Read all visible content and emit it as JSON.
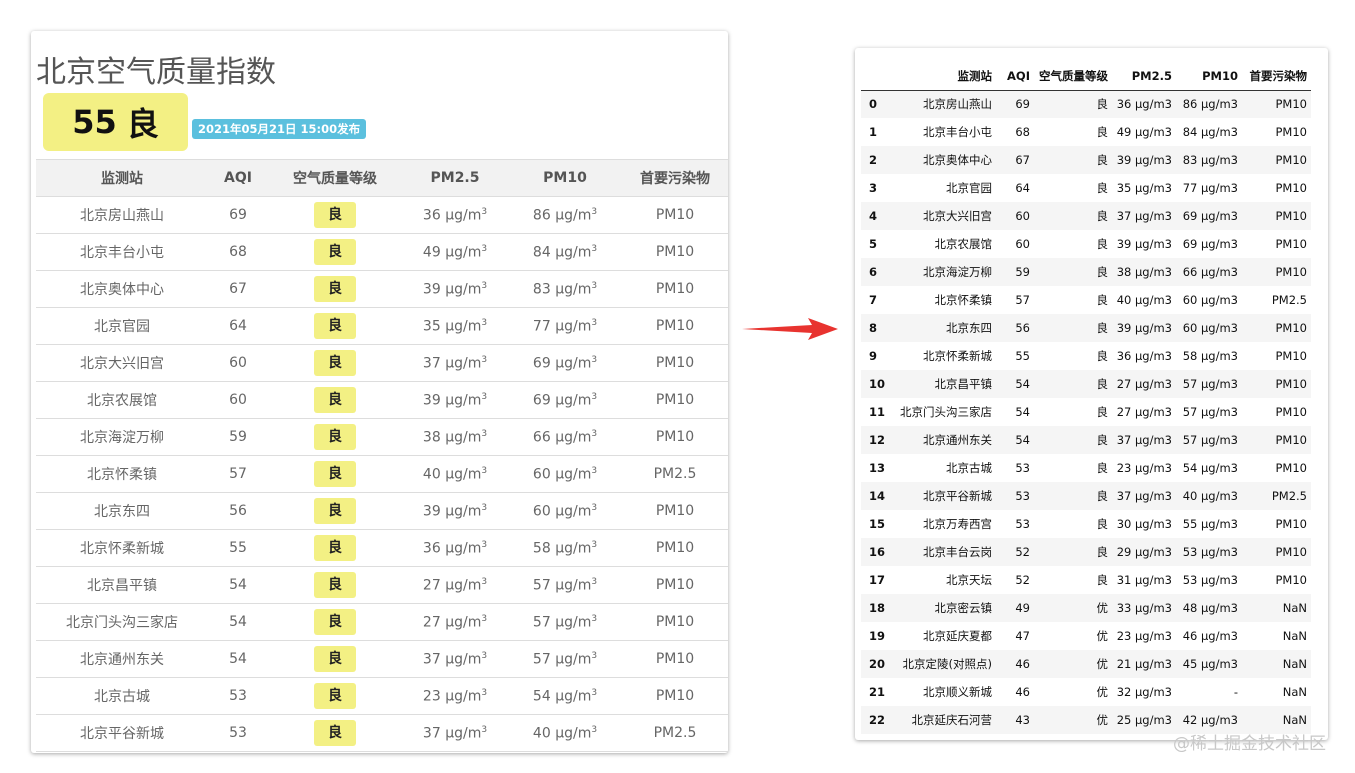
{
  "title": "北京空气质量指数",
  "aqi_badge": {
    "value": "55",
    "level": "良"
  },
  "publish_time": "2021年05月21日 15:00发布",
  "left_table": {
    "headers": [
      "监测站",
      "AQI",
      "空气质量等级",
      "PM2.5",
      "PM10",
      "首要污染物"
    ],
    "unit": "μg/m",
    "unit_sup": "3",
    "rows": [
      {
        "station": "北京房山燕山",
        "aqi": "69",
        "level": "良",
        "pm25": "36",
        "pm10": "86",
        "pollutant": "PM10"
      },
      {
        "station": "北京丰台小屯",
        "aqi": "68",
        "level": "良",
        "pm25": "49",
        "pm10": "84",
        "pollutant": "PM10"
      },
      {
        "station": "北京奥体中心",
        "aqi": "67",
        "level": "良",
        "pm25": "39",
        "pm10": "83",
        "pollutant": "PM10"
      },
      {
        "station": "北京官园",
        "aqi": "64",
        "level": "良",
        "pm25": "35",
        "pm10": "77",
        "pollutant": "PM10"
      },
      {
        "station": "北京大兴旧宫",
        "aqi": "60",
        "level": "良",
        "pm25": "37",
        "pm10": "69",
        "pollutant": "PM10"
      },
      {
        "station": "北京农展馆",
        "aqi": "60",
        "level": "良",
        "pm25": "39",
        "pm10": "69",
        "pollutant": "PM10"
      },
      {
        "station": "北京海淀万柳",
        "aqi": "59",
        "level": "良",
        "pm25": "38",
        "pm10": "66",
        "pollutant": "PM10"
      },
      {
        "station": "北京怀柔镇",
        "aqi": "57",
        "level": "良",
        "pm25": "40",
        "pm10": "60",
        "pollutant": "PM2.5"
      },
      {
        "station": "北京东四",
        "aqi": "56",
        "level": "良",
        "pm25": "39",
        "pm10": "60",
        "pollutant": "PM10"
      },
      {
        "station": "北京怀柔新城",
        "aqi": "55",
        "level": "良",
        "pm25": "36",
        "pm10": "58",
        "pollutant": "PM10"
      },
      {
        "station": "北京昌平镇",
        "aqi": "54",
        "level": "良",
        "pm25": "27",
        "pm10": "57",
        "pollutant": "PM10"
      },
      {
        "station": "北京门头沟三家店",
        "aqi": "54",
        "level": "良",
        "pm25": "27",
        "pm10": "57",
        "pollutant": "PM10"
      },
      {
        "station": "北京通州东关",
        "aqi": "54",
        "level": "良",
        "pm25": "37",
        "pm10": "57",
        "pollutant": "PM10"
      },
      {
        "station": "北京古城",
        "aqi": "53",
        "level": "良",
        "pm25": "23",
        "pm10": "54",
        "pollutant": "PM10"
      },
      {
        "station": "北京平谷新城",
        "aqi": "53",
        "level": "良",
        "pm25": "37",
        "pm10": "40",
        "pollutant": "PM2.5"
      }
    ]
  },
  "right_table": {
    "headers": [
      "",
      "监测站",
      "AQI",
      "空气质量等级",
      "PM2.5",
      "PM10",
      "首要污染物"
    ],
    "rows": [
      [
        "0",
        "北京房山燕山",
        "69",
        "良",
        "36 μg/m3",
        "86 μg/m3",
        "PM10"
      ],
      [
        "1",
        "北京丰台小屯",
        "68",
        "良",
        "49 μg/m3",
        "84 μg/m3",
        "PM10"
      ],
      [
        "2",
        "北京奥体中心",
        "67",
        "良",
        "39 μg/m3",
        "83 μg/m3",
        "PM10"
      ],
      [
        "3",
        "北京官园",
        "64",
        "良",
        "35 μg/m3",
        "77 μg/m3",
        "PM10"
      ],
      [
        "4",
        "北京大兴旧宫",
        "60",
        "良",
        "37 μg/m3",
        "69 μg/m3",
        "PM10"
      ],
      [
        "5",
        "北京农展馆",
        "60",
        "良",
        "39 μg/m3",
        "69 μg/m3",
        "PM10"
      ],
      [
        "6",
        "北京海淀万柳",
        "59",
        "良",
        "38 μg/m3",
        "66 μg/m3",
        "PM10"
      ],
      [
        "7",
        "北京怀柔镇",
        "57",
        "良",
        "40 μg/m3",
        "60 μg/m3",
        "PM2.5"
      ],
      [
        "8",
        "北京东四",
        "56",
        "良",
        "39 μg/m3",
        "60 μg/m3",
        "PM10"
      ],
      [
        "9",
        "北京怀柔新城",
        "55",
        "良",
        "36 μg/m3",
        "58 μg/m3",
        "PM10"
      ],
      [
        "10",
        "北京昌平镇",
        "54",
        "良",
        "27 μg/m3",
        "57 μg/m3",
        "PM10"
      ],
      [
        "11",
        "北京门头沟三家店",
        "54",
        "良",
        "27 μg/m3",
        "57 μg/m3",
        "PM10"
      ],
      [
        "12",
        "北京通州东关",
        "54",
        "良",
        "37 μg/m3",
        "57 μg/m3",
        "PM10"
      ],
      [
        "13",
        "北京古城",
        "53",
        "良",
        "23 μg/m3",
        "54 μg/m3",
        "PM10"
      ],
      [
        "14",
        "北京平谷新城",
        "53",
        "良",
        "37 μg/m3",
        "40 μg/m3",
        "PM2.5"
      ],
      [
        "15",
        "北京万寿西宫",
        "53",
        "良",
        "30 μg/m3",
        "55 μg/m3",
        "PM10"
      ],
      [
        "16",
        "北京丰台云岗",
        "52",
        "良",
        "29 μg/m3",
        "53 μg/m3",
        "PM10"
      ],
      [
        "17",
        "北京天坛",
        "52",
        "良",
        "31 μg/m3",
        "53 μg/m3",
        "PM10"
      ],
      [
        "18",
        "北京密云镇",
        "49",
        "优",
        "33 μg/m3",
        "48 μg/m3",
        "NaN"
      ],
      [
        "19",
        "北京延庆夏都",
        "47",
        "优",
        "23 μg/m3",
        "46 μg/m3",
        "NaN"
      ],
      [
        "20",
        "北京定陵(对照点)",
        "46",
        "优",
        "21 μg/m3",
        "45 μg/m3",
        "NaN"
      ],
      [
        "21",
        "北京顺义新城",
        "46",
        "优",
        "32 μg/m3",
        "-",
        "NaN"
      ],
      [
        "22",
        "北京延庆石河营",
        "43",
        "优",
        "25 μg/m3",
        "42 μg/m3",
        "NaN"
      ]
    ]
  },
  "watermark": "@稀土掘金技术社区",
  "colors": {
    "badge_yellow": "#f3f084",
    "tag_blue": "#5bc0de",
    "arrow_red": "#e8332f"
  }
}
